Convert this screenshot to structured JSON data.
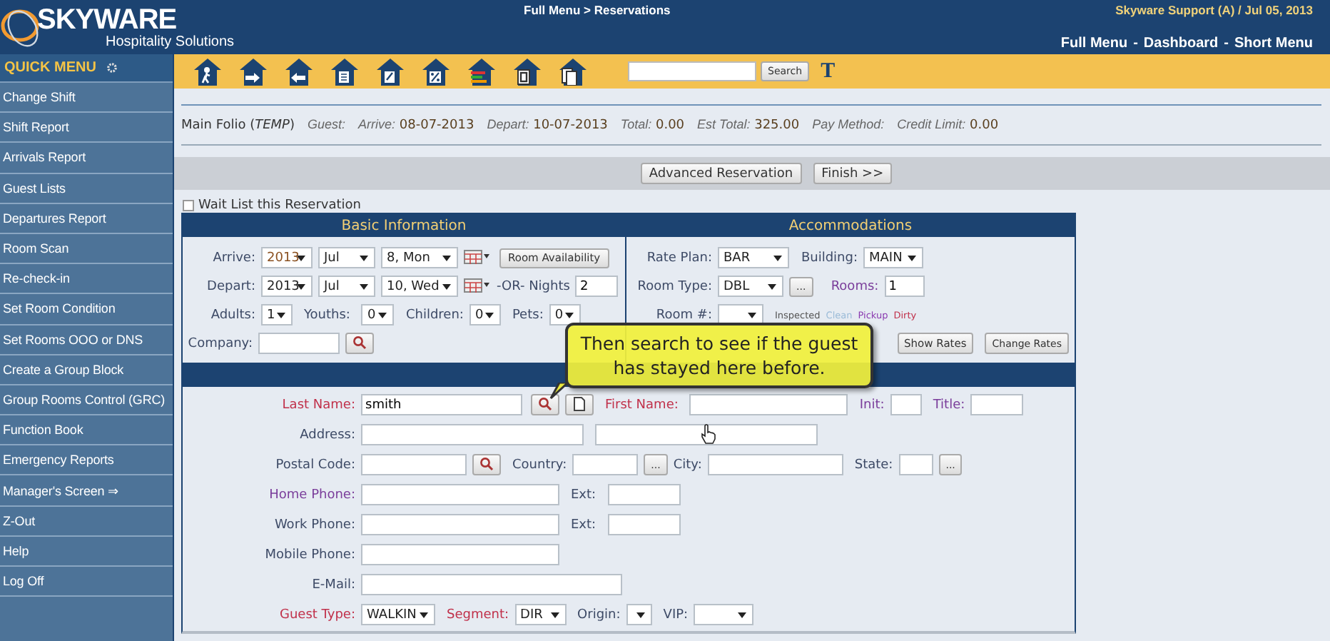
{
  "header": {
    "logo_title": "SKYWARE",
    "logo_subtitle": "Hospitality Solutions",
    "breadcrumb": "Full Menu > Reservations",
    "user_info": "Skyware Support (A) / Jul 05, 2013",
    "nav_separator": "-",
    "nav_links": [
      "Full Menu",
      "Dashboard",
      "Short Menu"
    ]
  },
  "sidebar": {
    "title": "QUICK MENU",
    "items": [
      "Change Shift",
      "Shift Report",
      "Arrivals Report",
      "Guest Lists",
      "Departures Report",
      "Room Scan",
      "Re-check-in",
      "Set Room Condition",
      "Set Rooms OOO or DNS",
      "Create a Group Block",
      "Group Rooms Control (GRC)",
      "Function Book",
      "Emergency Reports",
      "Manager's Screen ⇒",
      "Z-Out",
      "Help",
      "Log Off"
    ]
  },
  "toolbar": {
    "search_button": "Search",
    "font_icon": "T"
  },
  "folio": {
    "title": "Main Folio (*TEMP*)",
    "fields": [
      {
        "label": "Guest:"
      },
      {
        "label": "Arrive:",
        "value": "08-07-2013"
      },
      {
        "label": "Depart:",
        "value": "10-07-2013"
      },
      {
        "label": "Total:",
        "value": "0.00"
      },
      {
        "label": "Est Total:",
        "value": "325.00"
      },
      {
        "label": "Pay Method:"
      },
      {
        "label": "Credit Limit:",
        "value": "0.00"
      }
    ]
  },
  "actions": [
    "Advanced Reservation",
    "Finish >>"
  ],
  "wait_list": {
    "label": "Wait List this Reservation",
    "checked": false
  },
  "basic_info": {
    "title": "Basic Information",
    "arrive": {
      "label": "Arrive:",
      "year": "2013",
      "month": "Jul",
      "day": "8, Mon"
    },
    "room_availability": "Room Availability",
    "depart": {
      "label": "Depart:",
      "year": "2013",
      "month": "Jul",
      "day": "10, Wed"
    },
    "nights": {
      "label": "-OR- Nights",
      "value": "2"
    },
    "adults": {
      "label": "Adults:",
      "value": "1"
    },
    "youths": {
      "label": "Youths:",
      "value": "0"
    },
    "children": {
      "label": "Children:",
      "value": "0"
    },
    "pets": {
      "label": "Pets:",
      "value": "0"
    },
    "company": {
      "label": "Company:"
    }
  },
  "accommodations": {
    "title": "Accommodations",
    "rate_plan": {
      "label": "Rate Plan:",
      "value": "BAR"
    },
    "building": {
      "label": "Building:",
      "value": "MAIN"
    },
    "room_type": {
      "label": "Room Type:",
      "value": "DBL"
    },
    "more": "...",
    "rooms": {
      "label": "Rooms:",
      "value": "1"
    },
    "room_number": {
      "label": "Room #:"
    },
    "legend": [
      {
        "label": "Inspected",
        "color": "#555555"
      },
      {
        "label": "Clean",
        "color": "#9bbbd8"
      },
      {
        "label": "Pickup",
        "color": "#8a3ab0"
      },
      {
        "label": "Dirty",
        "color": "#c0304a"
      }
    ],
    "show_rates": "Show Rates",
    "change_rates": "Change Rates"
  },
  "guest": {
    "last_name": {
      "label": "Last Name:",
      "value": "smith"
    },
    "first_name": {
      "label": "First Name:"
    },
    "init": {
      "label": "Init:"
    },
    "title": {
      "label": "Title:"
    },
    "address": {
      "label": "Address:"
    },
    "postal_code": {
      "label": "Postal Code:"
    },
    "country": {
      "label": "Country:"
    },
    "country_more": "...",
    "city": {
      "label": "City:"
    },
    "state": {
      "label": "State:"
    },
    "state_more": "...",
    "home_phone": {
      "label": "Home Phone:"
    },
    "home_ext": {
      "label": "Ext:"
    },
    "work_phone": {
      "label": "Work Phone:"
    },
    "work_ext": {
      "label": "Ext:"
    },
    "mobile_phone": {
      "label": "Mobile Phone:"
    },
    "email": {
      "label": "E-Mail:"
    },
    "guest_type": {
      "label": "Guest Type:",
      "value": "WALKIN"
    },
    "segment": {
      "label": "Segment:",
      "value": "DIR"
    },
    "origin": {
      "label": "Origin:"
    },
    "vip": {
      "label": "VIP:"
    }
  },
  "tooltip": "Then search to see if the guest has stayed here before."
}
